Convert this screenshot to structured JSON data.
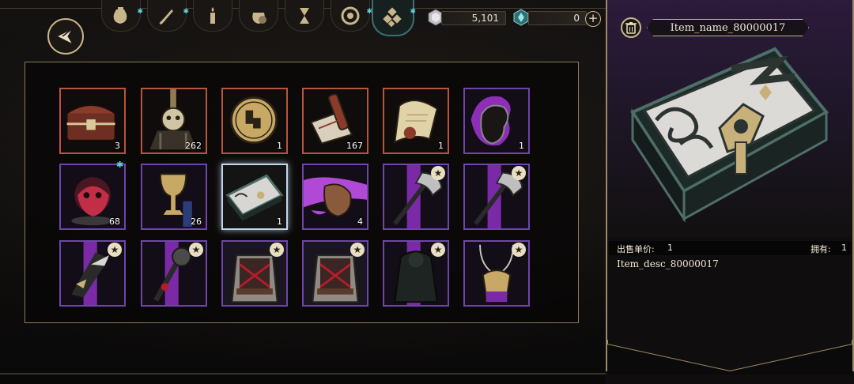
{
  "tabs": [
    {
      "icon": "pouch-icon",
      "badge": true
    },
    {
      "icon": "dagger-icon",
      "badge": true
    },
    {
      "icon": "candle-icon",
      "badge": false
    },
    {
      "icon": "coin-bag-icon",
      "badge": false
    },
    {
      "icon": "hourglass-icon",
      "badge": false
    },
    {
      "icon": "wheel-icon",
      "badge": true
    },
    {
      "icon": "gems-icon",
      "badge": true,
      "active": true
    }
  ],
  "currency": {
    "silver": {
      "icon": "silver-crystal-icon",
      "value": "5,101"
    },
    "gem": {
      "icon": "teal-gem-icon",
      "value": "0"
    },
    "plus_label": "+"
  },
  "slots": [
    {
      "icon": "treasure-chest-icon",
      "rarity": "red",
      "count": "3"
    },
    {
      "icon": "skull-pillar-icon",
      "rarity": "red",
      "count": "262"
    },
    {
      "icon": "gold-coin-icon",
      "rarity": "red",
      "count": "1"
    },
    {
      "icon": "scroll-bundle-icon",
      "rarity": "red",
      "count": "167"
    },
    {
      "icon": "parchment-icon",
      "rarity": "red",
      "count": "1"
    },
    {
      "icon": "dark-vessel-icon",
      "rarity": "purple",
      "count": "1"
    },
    {
      "icon": "red-mask-icon",
      "rarity": "purple",
      "count": "68",
      "badge": true
    },
    {
      "icon": "golden-chalice-icon",
      "rarity": "purple",
      "count": "26"
    },
    {
      "icon": "ornate-box-icon",
      "rarity": "purple",
      "count": "1",
      "selected": true
    },
    {
      "icon": "leather-pouch-icon",
      "rarity": "purple",
      "count": "4"
    },
    {
      "icon": "war-axe-icon",
      "rarity": "purple",
      "star": true
    },
    {
      "icon": "war-axe-icon",
      "rarity": "purple",
      "star": true
    },
    {
      "icon": "claw-blade-icon",
      "rarity": "purple",
      "star": true
    },
    {
      "icon": "heavy-mace-icon",
      "rarity": "purple",
      "star": true
    },
    {
      "icon": "fur-armor-icon",
      "rarity": "purple",
      "star": true
    },
    {
      "icon": "fur-armor-icon",
      "rarity": "purple",
      "star": true
    },
    {
      "icon": "dark-cloak-icon",
      "rarity": "purple",
      "star": true
    },
    {
      "icon": "chain-pendant-icon",
      "rarity": "purple",
      "star": true
    }
  ],
  "star_glyph": "★",
  "detail": {
    "name": "Item_name_80000017",
    "price_label": "出售单价:",
    "price_value": "1",
    "owned_label": "拥有:",
    "owned_value": "1",
    "description": "Item_desc_80000017"
  },
  "colors": {
    "rarity_red": "#b8553d",
    "rarity_purple": "#6d46a9",
    "accent_gold": "#c9b58a",
    "badge_teal": "#5fd3d9"
  }
}
